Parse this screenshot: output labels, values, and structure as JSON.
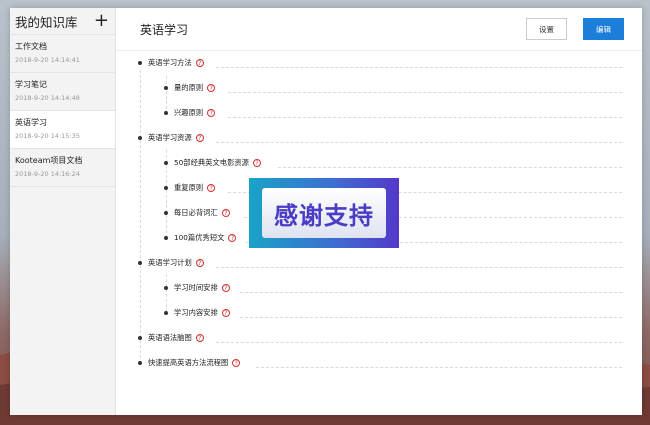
{
  "sidebar": {
    "title": "我的知识库",
    "add_label": "+",
    "docs": [
      {
        "title": "工作文档",
        "time": "2018-9-20 14:14:41"
      },
      {
        "title": "学习笔记",
        "time": "2018-9-20 14:14:48"
      },
      {
        "title": "英语学习",
        "time": "2018-9-20 14:15:35"
      },
      {
        "title": "Kooteam项目文档",
        "time": "2018-9-20 14:16:24"
      }
    ]
  },
  "header": {
    "title": "英语学习",
    "settings_label": "设置",
    "edit_label": "编辑"
  },
  "tree": {
    "q_icon": "?",
    "n1": "英语学习方法",
    "n1a": "量的原则",
    "n1b": "兴趣原则",
    "n2": "英语学习资源",
    "n2a": "50部经典英文电影资源",
    "n2b": "重复原则",
    "n2c": "每日必背词汇",
    "n2d": "100篇优秀短文",
    "n3": "英语学习计划",
    "n3a": "学习时间安排",
    "n3b": "学习内容安排",
    "n4": "英语语法脑图",
    "n5": "快速提高英语方法流程图"
  },
  "overlay": {
    "text": "感谢支持"
  },
  "colors": {
    "primary": "#1b7ed8",
    "question": "#d2332f"
  }
}
